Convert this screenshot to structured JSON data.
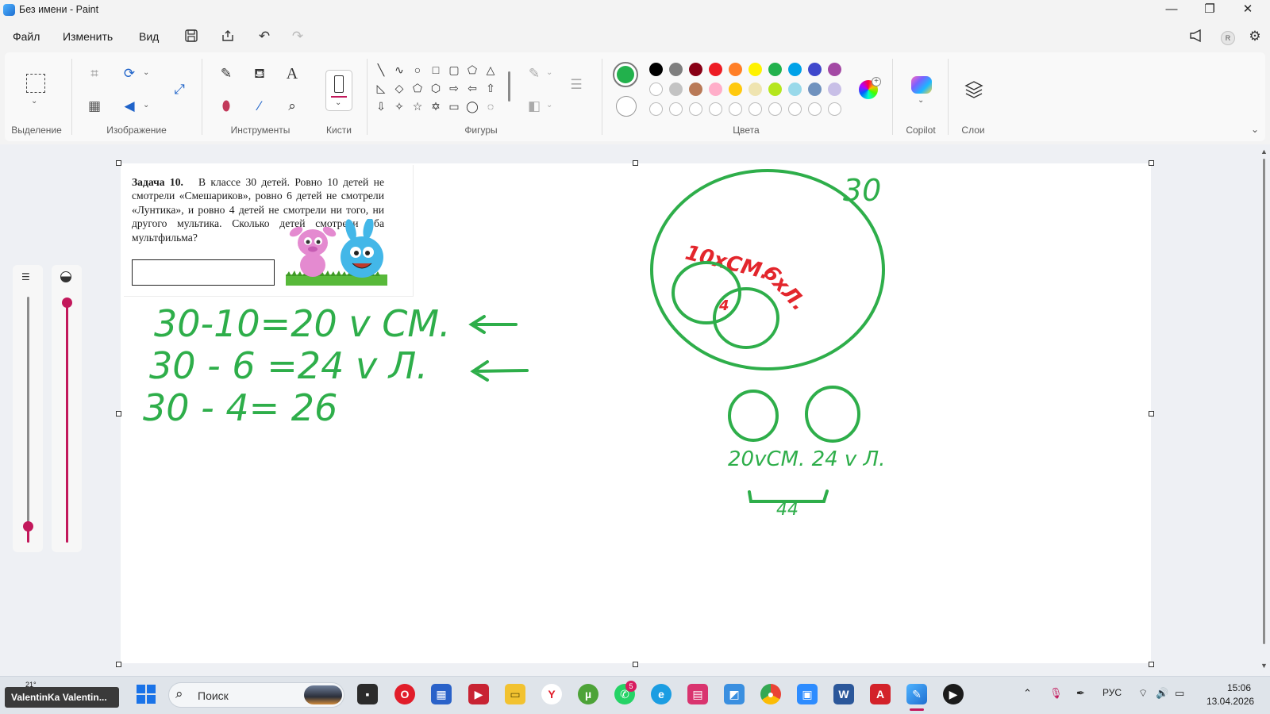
{
  "window": {
    "title": "Без имени - Paint"
  },
  "menu": {
    "file": "Файл",
    "edit": "Изменить",
    "view": "Вид"
  },
  "ribbon": {
    "groups": {
      "selection": "Выделение",
      "image": "Изображение",
      "tools": "Инструменты",
      "brushes": "Кисти",
      "shapes": "Фигуры",
      "colors": "Цвета",
      "copilot": "Copilot",
      "layers": "Слои"
    },
    "active_color": "#22b14c",
    "palette_row1": [
      "#000000",
      "#7f7f7f",
      "#880015",
      "#ed1c24",
      "#ff7f27",
      "#fff200",
      "#22b14c",
      "#00a2e8",
      "#3f48cc",
      "#a349a4"
    ],
    "palette_row2": [
      "#ffffff",
      "#c3c3c3",
      "#b97a57",
      "#ffaec9",
      "#ffc90e",
      "#efe4b0",
      "#b5e61d",
      "#99d9ea",
      "#7092be",
      "#c8bfe7"
    ]
  },
  "problem": {
    "heading": "Задача 10.",
    "body": "В классе 30 детей. Ровно 10 детей не смотрели «Смешариков», ровно 6 детей не смотрели «Лунтика», и ровно 4 детей не смотрели ни того, ни другого мультика. Сколько детей смотрели оба мультфильма?"
  },
  "handwriting": {
    "line1": "30-10=20 v СМ.",
    "line2": "30 - 6 =24 v Л.",
    "line3": "30 - 4= 26",
    "total": "30",
    "venn_label_a": "10xСМ.",
    "venn_label_b": "6xЛ.",
    "venn_inner": "4",
    "bottom_label": "20vСМ. 24 v Л.",
    "sum": "44"
  },
  "taskbar": {
    "user_widget": "ValentinKa Valentin...",
    "weather": "21°",
    "search_placeholder": "Поиск",
    "whatsapp_badge": "5",
    "language": "РУС",
    "time": "15:06",
    "date": "13.04.2026"
  }
}
